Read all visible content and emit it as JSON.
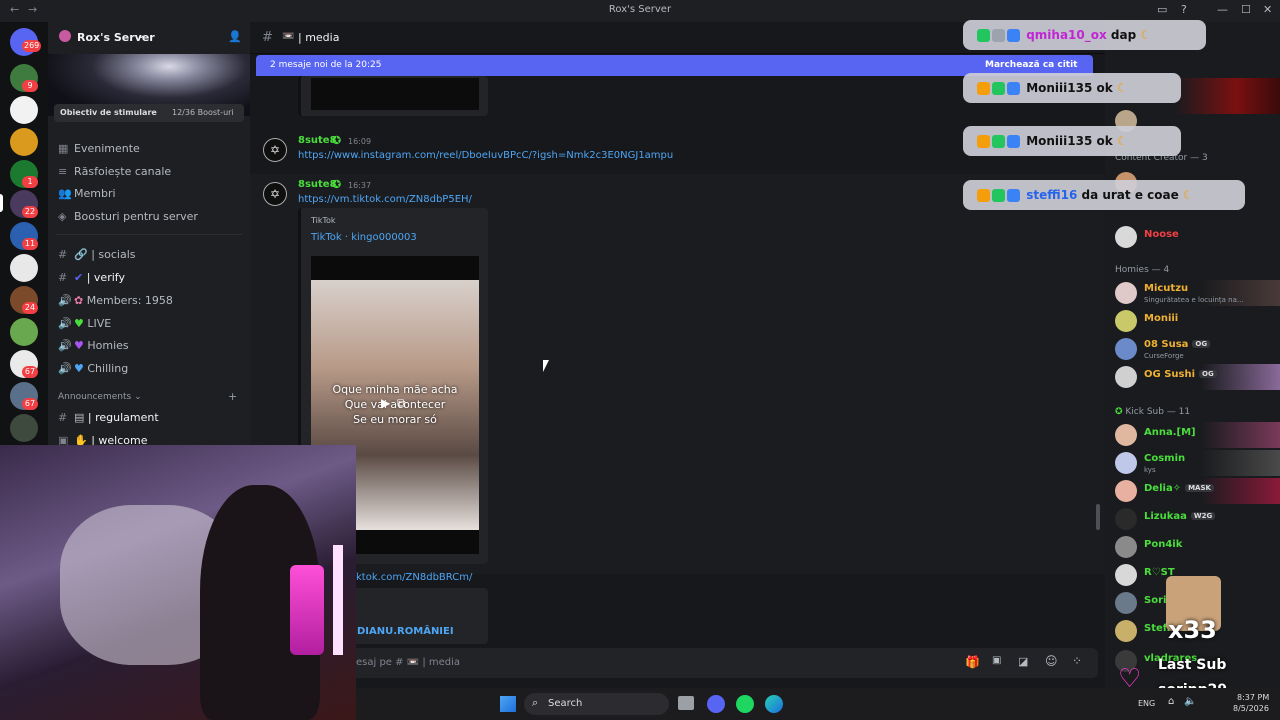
{
  "window": {
    "title": "Rox's Server"
  },
  "server": {
    "name": "Rox's Server",
    "boost_goal": "Obiectiv de stimulare",
    "boost_count": "12/36 Boost-uri",
    "menu": [
      "Evenimente",
      "Răsfoiește canale",
      "Membri",
      "Boosturi pentru server"
    ],
    "channels": [
      {
        "icon": "#",
        "name": "| socials"
      },
      {
        "icon": "#",
        "name": "| verify"
      },
      {
        "icon": "🔊",
        "name": "Members: 1958"
      },
      {
        "icon": "🔊",
        "name": "LIVE"
      },
      {
        "icon": "🔊",
        "name": "Homies"
      },
      {
        "icon": "🔊",
        "name": "Chilling"
      }
    ],
    "category": "Announcements",
    "announce_channels": [
      "| regulament",
      "| welcome"
    ]
  },
  "rail_badges": [
    "269",
    "9",
    "1",
    "22",
    "11",
    "24",
    "67",
    "67"
  ],
  "channel": {
    "name": "| media",
    "new_messages": "2 mesaje noi de la 20:25",
    "mark_read": "Marchează ca citit"
  },
  "messages": [
    {
      "user": "8sute8",
      "time": "16:09",
      "link": "https://www.instagram.com/reel/DboeIuvBPcC/?igsh=Nmk2c3E0NGJ1ampu"
    },
    {
      "user": "8sute8",
      "time": "16:37",
      "link": "https://vm.tiktok.com/ZN8dbP5EH/",
      "embed": {
        "provider": "TikTok",
        "title": "TikTok · kingo000003",
        "caption": [
          "Oque minha mãe acha",
          "Que vai acontecer",
          "Se eu morar só"
        ]
      }
    }
  ],
  "partial": {
    "link": "ktok.com/ZN8dbBRCm/",
    "text": "DIANU.ROMÂNIEI"
  },
  "composer": {
    "placeholder": "esaj pe # 📼 | media"
  },
  "members": {
    "groups": [
      {
        "label": "Content Creator — 3"
      },
      {
        "label": "Homies — 4"
      },
      {
        "label": "Kick Sub — 11"
      }
    ],
    "content_creator": [
      {
        "name": "Noose",
        "color": "#f23f43"
      }
    ],
    "homies": [
      {
        "name": "Micutzu",
        "sub": "Singurătatea e locuința na...",
        "color": "#f0b132"
      },
      {
        "name": "Moniii",
        "color": "#f0b132"
      },
      {
        "name": "08 Susa",
        "tag": "OG",
        "sub": "CurseForge",
        "color": "#f0b132"
      },
      {
        "name": "OG Sushi",
        "tag": "OG",
        "color": "#f0b132"
      }
    ],
    "kick_sub": [
      {
        "name": "Anna.[M]",
        "color": "#4ade3c"
      },
      {
        "name": "Cosmin",
        "sub": "kys",
        "color": "#4ade3c"
      },
      {
        "name": "Delia✧",
        "tag": "MASK",
        "color": "#4ade3c"
      },
      {
        "name": "Lizukaa",
        "tag": "W2G",
        "color": "#4ade3c"
      },
      {
        "name": "Pon4ik",
        "color": "#4ade3c"
      },
      {
        "name": "R♡ST",
        "color": "#4ade3c"
      },
      {
        "name": "Sori",
        "color": "#4ade3c"
      },
      {
        "name": "Steff",
        "color": "#4ade3c"
      },
      {
        "name": "vladrares",
        "color": "#4ade3c"
      }
    ]
  },
  "overlay_chat": [
    {
      "user": "qmiha10_ox",
      "msg": "dap",
      "ucolor": "#c026d3"
    },
    {
      "user": "Moniii135",
      "msg": "ok",
      "ucolor": "#111"
    },
    {
      "user": "Moniii135",
      "msg": "ok",
      "ucolor": "#111"
    },
    {
      "user": "steffi16",
      "msg": "da urat e coae",
      "ucolor": "#2563eb"
    }
  ],
  "last_sub": {
    "count": "x33",
    "label": "Last Sub",
    "name": "sorinp29"
  },
  "taskbar": {
    "search": "Search",
    "lang": "ENG",
    "time": "8:37 PM",
    "date": "8/5/2026"
  }
}
